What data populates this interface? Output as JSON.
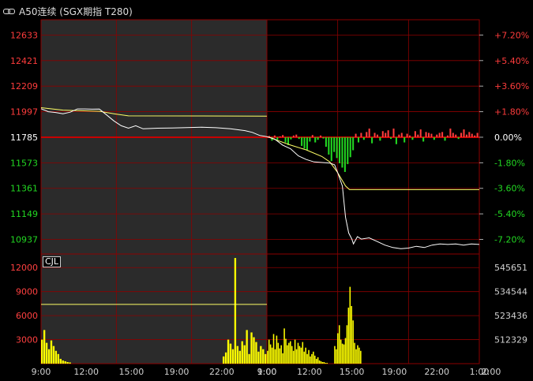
{
  "header": {
    "title": "A50连续 (SGX期指 T280)",
    "icon": "link-icon"
  },
  "colors": {
    "background": "#000000",
    "grid": "#8b0000",
    "up": "#ff3c3c",
    "down": "#22d822",
    "baseline_label": "#ffffff",
    "price_line": "#ffffff",
    "avg_line": "#ffff66",
    "volume": "#ffff00",
    "prev_session_bg": "#2b2b2b"
  },
  "chart_data": [
    {
      "type": "line",
      "name": "price",
      "title": "",
      "y_ticks_left": [
        "12633",
        "12421",
        "12209",
        "11997",
        "11785",
        "11573",
        "11361",
        "11149",
        "10937"
      ],
      "y_ticks_right": [
        "+7.20%",
        "+5.40%",
        "+3.60%",
        "+1.80%",
        "0.00%",
        "-1.80%",
        "-3.60%",
        "-5.40%",
        "-7.20%"
      ],
      "baseline": 11785,
      "ylim": [
        10816,
        12760
      ],
      "x_ticks": [
        "9:00",
        "12:00",
        "15:00",
        "19:00",
        "22:00",
        "1:00",
        "9:00",
        "12:00",
        "15:00",
        "19:00",
        "22:00",
        "1:00"
      ],
      "x_ticks_end": "2:00",
      "prev_session": {
        "price": [
          [
            0,
            12022
          ],
          [
            1,
            11997
          ],
          [
            2,
            11990
          ],
          [
            3,
            11980
          ],
          [
            4,
            11993
          ],
          [
            5,
            12020
          ],
          [
            6,
            12020
          ],
          [
            7,
            12018
          ],
          [
            8,
            12019
          ],
          [
            9,
            11970
          ],
          [
            10,
            11920
          ],
          [
            11,
            11880
          ],
          [
            12,
            11860
          ],
          [
            13,
            11880
          ],
          [
            14,
            11855
          ],
          [
            16,
            11860
          ],
          [
            18,
            11862
          ],
          [
            20,
            11865
          ],
          [
            22,
            11868
          ],
          [
            24,
            11864
          ],
          [
            26,
            11855
          ],
          [
            28,
            11840
          ],
          [
            29,
            11825
          ],
          [
            30,
            11800
          ],
          [
            31,
            11790
          ]
        ],
        "avg": [
          [
            0,
            12030
          ],
          [
            3,
            12010
          ],
          [
            5,
            12005
          ],
          [
            8,
            12000
          ],
          [
            10,
            11980
          ],
          [
            12,
            11962
          ],
          [
            31,
            11960
          ]
        ]
      },
      "curr_session": {
        "price": [
          [
            0,
            11790
          ],
          [
            1,
            11770
          ],
          [
            2,
            11720
          ],
          [
            3,
            11690
          ],
          [
            4,
            11630
          ],
          [
            5,
            11600
          ],
          [
            6,
            11580
          ],
          [
            7,
            11575
          ],
          [
            8,
            11570
          ],
          [
            8.6,
            11556
          ],
          [
            9,
            11490
          ],
          [
            9.6,
            11380
          ],
          [
            10,
            11120
          ],
          [
            10.4,
            10990
          ],
          [
            10.8,
            10940
          ],
          [
            11,
            10900
          ],
          [
            11.5,
            10960
          ],
          [
            12,
            10940
          ],
          [
            13,
            10950
          ],
          [
            14,
            10920
          ],
          [
            15,
            10890
          ],
          [
            16,
            10870
          ],
          [
            17,
            10860
          ],
          [
            18,
            10865
          ],
          [
            19,
            10880
          ],
          [
            20,
            10870
          ],
          [
            21,
            10890
          ],
          [
            22,
            10900
          ],
          [
            23,
            10895
          ],
          [
            24,
            10900
          ],
          [
            25,
            10890
          ],
          [
            26,
            10900
          ],
          [
            27,
            10895
          ]
        ],
        "avg": [
          [
            0,
            11790
          ],
          [
            3,
            11720
          ],
          [
            5,
            11680
          ],
          [
            7,
            11625
          ],
          [
            8,
            11580
          ],
          [
            9,
            11490
          ],
          [
            10,
            11380
          ],
          [
            10.5,
            11350
          ],
          [
            11,
            11350
          ],
          [
            27,
            11350
          ]
        ]
      },
      "diff_bars": [
        3,
        -8,
        4,
        -6,
        2,
        5,
        -12,
        -18,
        -5,
        4,
        6,
        -4,
        -20,
        -26,
        -30,
        -10,
        5,
        -12,
        -6,
        4,
        -3,
        -22,
        -40,
        -55,
        -34,
        -48,
        -60,
        -70,
        -80,
        -62,
        -46,
        -30,
        8,
        -12,
        10,
        -6,
        12,
        20,
        -14,
        10,
        6,
        -8,
        14,
        10,
        16,
        -4,
        20,
        -16,
        6,
        10,
        -12,
        8,
        4,
        -6,
        14,
        6,
        18,
        -10,
        12,
        10,
        8,
        -6,
        6,
        10,
        12,
        -8,
        4,
        20,
        10,
        6,
        -4,
        10,
        18,
        6,
        12,
        8,
        4,
        10
      ]
    },
    {
      "type": "bar",
      "name": "CJL",
      "y_ticks_left": [
        "12000",
        "9000",
        "6000",
        "3000"
      ],
      "y_ticks_right": [
        "545651",
        "534544",
        "523436",
        "512329"
      ],
      "ylim": [
        0,
        13700
      ],
      "prev_session_level": 7400,
      "prev_session": [
        3000,
        4200,
        2600,
        1800,
        2900,
        2200,
        1600,
        1200,
        600,
        400,
        300,
        200,
        150,
        0,
        0,
        0,
        0,
        0,
        0,
        0,
        0,
        0,
        0,
        0,
        0,
        0,
        0,
        0,
        0,
        0,
        0,
        0,
        0,
        0,
        0,
        0,
        0,
        0,
        0,
        0,
        0,
        0,
        0,
        0,
        0,
        0,
        0,
        0,
        0,
        0,
        0,
        0,
        0,
        0,
        0,
        0,
        0,
        0,
        0,
        0,
        0,
        0,
        0,
        0,
        0,
        0,
        0,
        0,
        0,
        0,
        0,
        0,
        0,
        0,
        0,
        0,
        0,
        0,
        900,
        1400,
        3000,
        2500,
        1800,
        13200,
        2200,
        1600,
        2800,
        2300,
        4200,
        1200,
        3900,
        3300,
        2700,
        1500,
        2200,
        1800,
        1200
      ],
      "curr_session": [
        1600,
        3000,
        2400,
        2000,
        3700,
        1800,
        3500,
        2600,
        1900,
        2300,
        1300,
        4400,
        3100,
        2300,
        2600,
        2800,
        2200,
        1600,
        3000,
        1800,
        2600,
        2200,
        2000,
        2700,
        1500,
        2000,
        1200,
        1700,
        900,
        1200,
        1500,
        1000,
        600,
        800,
        400,
        300,
        200,
        200,
        100,
        100,
        0,
        0,
        0,
        0,
        2200,
        1800,
        3800,
        4800,
        3000,
        2500,
        2400,
        3200,
        4800,
        7000,
        9600,
        7200,
        5400,
        2600,
        1800,
        2300,
        2000,
        1600
      ]
    }
  ],
  "indicator_label": "CJL"
}
